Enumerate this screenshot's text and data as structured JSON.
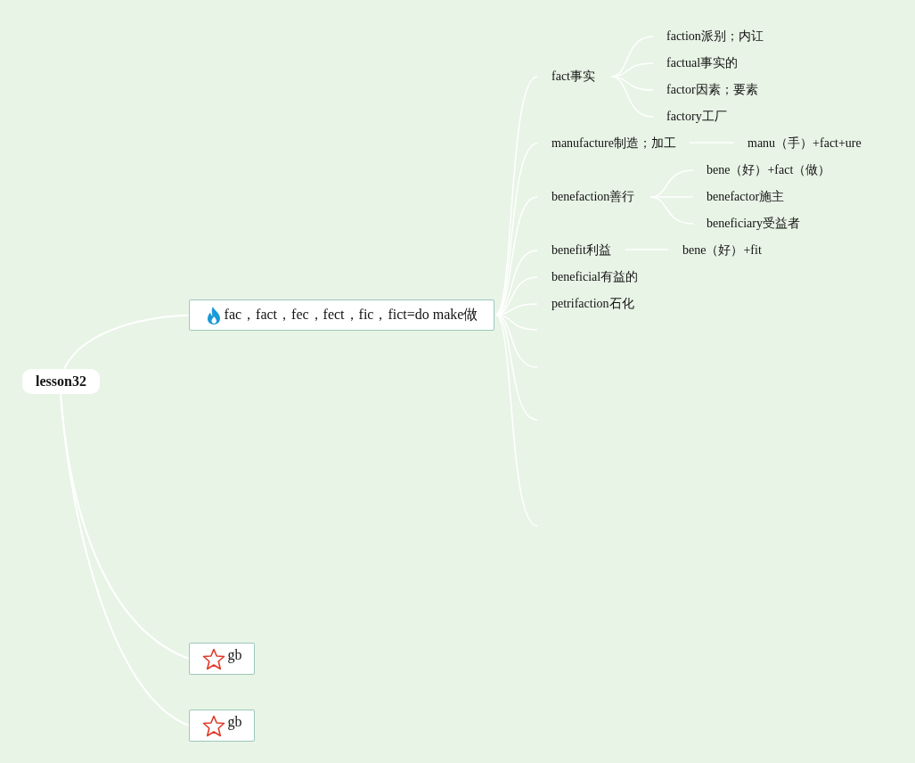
{
  "root": {
    "label": "lesson32",
    "children": [
      {
        "label": "fac，fact，fec，fect，fic，fict=do make做",
        "kind": "fire",
        "children": [
          {
            "label": "fact事实",
            "children": [
              {
                "label": "faction派别；内讧"
              },
              {
                "label": "factual事实的"
              },
              {
                "label": "factor因素；要素"
              },
              {
                "label": "factory工厂"
              }
            ]
          },
          {
            "label": "manufacture制造；加工",
            "children": [
              {
                "label": "manu（手）+fact+ure"
              }
            ]
          },
          {
            "label": "benefaction善行",
            "children": [
              {
                "label": "bene（好）+fact（做）"
              },
              {
                "label": "benefactor施主"
              },
              {
                "label": "beneficiary受益者"
              }
            ]
          },
          {
            "label": "benefit利益",
            "children": [
              {
                "label": "bene（好）+fit"
              }
            ]
          },
          {
            "label": "beneficial有益的"
          },
          {
            "label": "petrifaction石化"
          }
        ]
      },
      {
        "label": "gb",
        "kind": "star"
      },
      {
        "label": "gb",
        "kind": "star"
      }
    ]
  }
}
